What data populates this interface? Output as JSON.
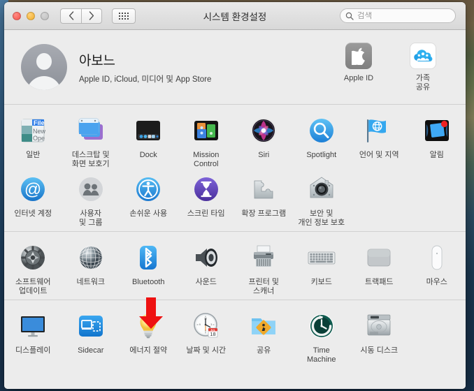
{
  "window": {
    "title": "시스템 환경설정",
    "traffic_lights": [
      {
        "name": "close",
        "color": "#f5514a"
      },
      {
        "name": "minimize",
        "color": "#f0ad2b"
      },
      {
        "name": "zoom",
        "color": "#c6c6c6"
      }
    ],
    "nav": {
      "back_icon": "chevron-left-icon",
      "forward_icon": "chevron-right-icon",
      "grid_icon": "grid-view-icon"
    }
  },
  "search": {
    "placeholder": "검색",
    "value": "",
    "icon": "search-icon"
  },
  "account": {
    "name": "아보느",
    "subtitle": "Apple ID, iCloud, 미디어 및 App Store",
    "avatar_icon": "user-avatar-icon",
    "actions": [
      {
        "id": "apple-id",
        "label": "Apple ID",
        "icon": "apple-logo-icon"
      },
      {
        "id": "family-sharing",
        "label": "가족\n공유",
        "icon": "family-sharing-icon"
      }
    ]
  },
  "sections": [
    {
      "id": "section-personal",
      "items": [
        {
          "id": "general",
          "label": "일반",
          "icon": "general-menu-icon"
        },
        {
          "id": "desktop",
          "label": "데스크탑 및\n화면 보호기",
          "icon": "desktop-screensaver-icon"
        },
        {
          "id": "dock",
          "label": "Dock",
          "icon": "dock-icon"
        },
        {
          "id": "mission-control",
          "label": "Mission\nControl",
          "icon": "mission-control-icon"
        },
        {
          "id": "siri",
          "label": "Siri",
          "icon": "siri-icon"
        },
        {
          "id": "spotlight",
          "label": "Spotlight",
          "icon": "spotlight-icon"
        },
        {
          "id": "language-region",
          "label": "언어 및 지역",
          "icon": "language-region-flag-icon"
        },
        {
          "id": "notifications",
          "label": "알림",
          "icon": "notifications-icon"
        },
        {
          "id": "internet-accounts",
          "label": "인터넷 계정",
          "icon": "at-sign-icon"
        },
        {
          "id": "users-groups",
          "label": "사용자\n및 그룹",
          "icon": "users-groups-icon"
        },
        {
          "id": "accessibility",
          "label": "손쉬운 사용",
          "icon": "accessibility-icon"
        },
        {
          "id": "screen-time",
          "label": "스크린 타임",
          "icon": "screen-time-hourglass-icon"
        },
        {
          "id": "extensions",
          "label": "확장 프로그램",
          "icon": "puzzle-piece-icon"
        },
        {
          "id": "security",
          "label": "보안 및\n개인 정보 보호",
          "icon": "security-house-icon"
        }
      ]
    },
    {
      "id": "section-hardware",
      "items": [
        {
          "id": "software-update",
          "label": "소프트웨어\n업데이트",
          "icon": "software-update-gear-icon"
        },
        {
          "id": "network",
          "label": "네트워크",
          "icon": "network-globe-icon"
        },
        {
          "id": "bluetooth",
          "label": "Bluetooth",
          "icon": "bluetooth-icon"
        },
        {
          "id": "sound",
          "label": "사운드",
          "icon": "speaker-icon"
        },
        {
          "id": "printers",
          "label": "프린터 및\n스캐너",
          "icon": "printer-icon"
        },
        {
          "id": "keyboard",
          "label": "키보드",
          "icon": "keyboard-icon"
        },
        {
          "id": "trackpad",
          "label": "트랙패드",
          "icon": "trackpad-icon"
        },
        {
          "id": "mouse",
          "label": "마우스",
          "icon": "mouse-icon"
        }
      ]
    },
    {
      "id": "section-system",
      "items": [
        {
          "id": "displays",
          "label": "디스플레이",
          "icon": "display-monitor-icon"
        },
        {
          "id": "sidecar",
          "label": "Sidecar",
          "icon": "sidecar-icon"
        },
        {
          "id": "energy-saver",
          "label": "에너지 절약",
          "icon": "lightbulb-icon"
        },
        {
          "id": "date-time",
          "label": "날짜 및 시간",
          "icon": "clock-calendar-icon"
        },
        {
          "id": "sharing",
          "label": "공유",
          "icon": "sharing-folder-icon"
        },
        {
          "id": "time-machine",
          "label": "Time\nMachine",
          "icon": "time-machine-icon"
        },
        {
          "id": "startup-disk",
          "label": "시동 디스크",
          "icon": "hard-disk-icon"
        }
      ]
    }
  ],
  "annotation": {
    "arrow_icon": "red-down-arrow-icon",
    "color": "#ee1111",
    "points_to": "energy-saver"
  }
}
